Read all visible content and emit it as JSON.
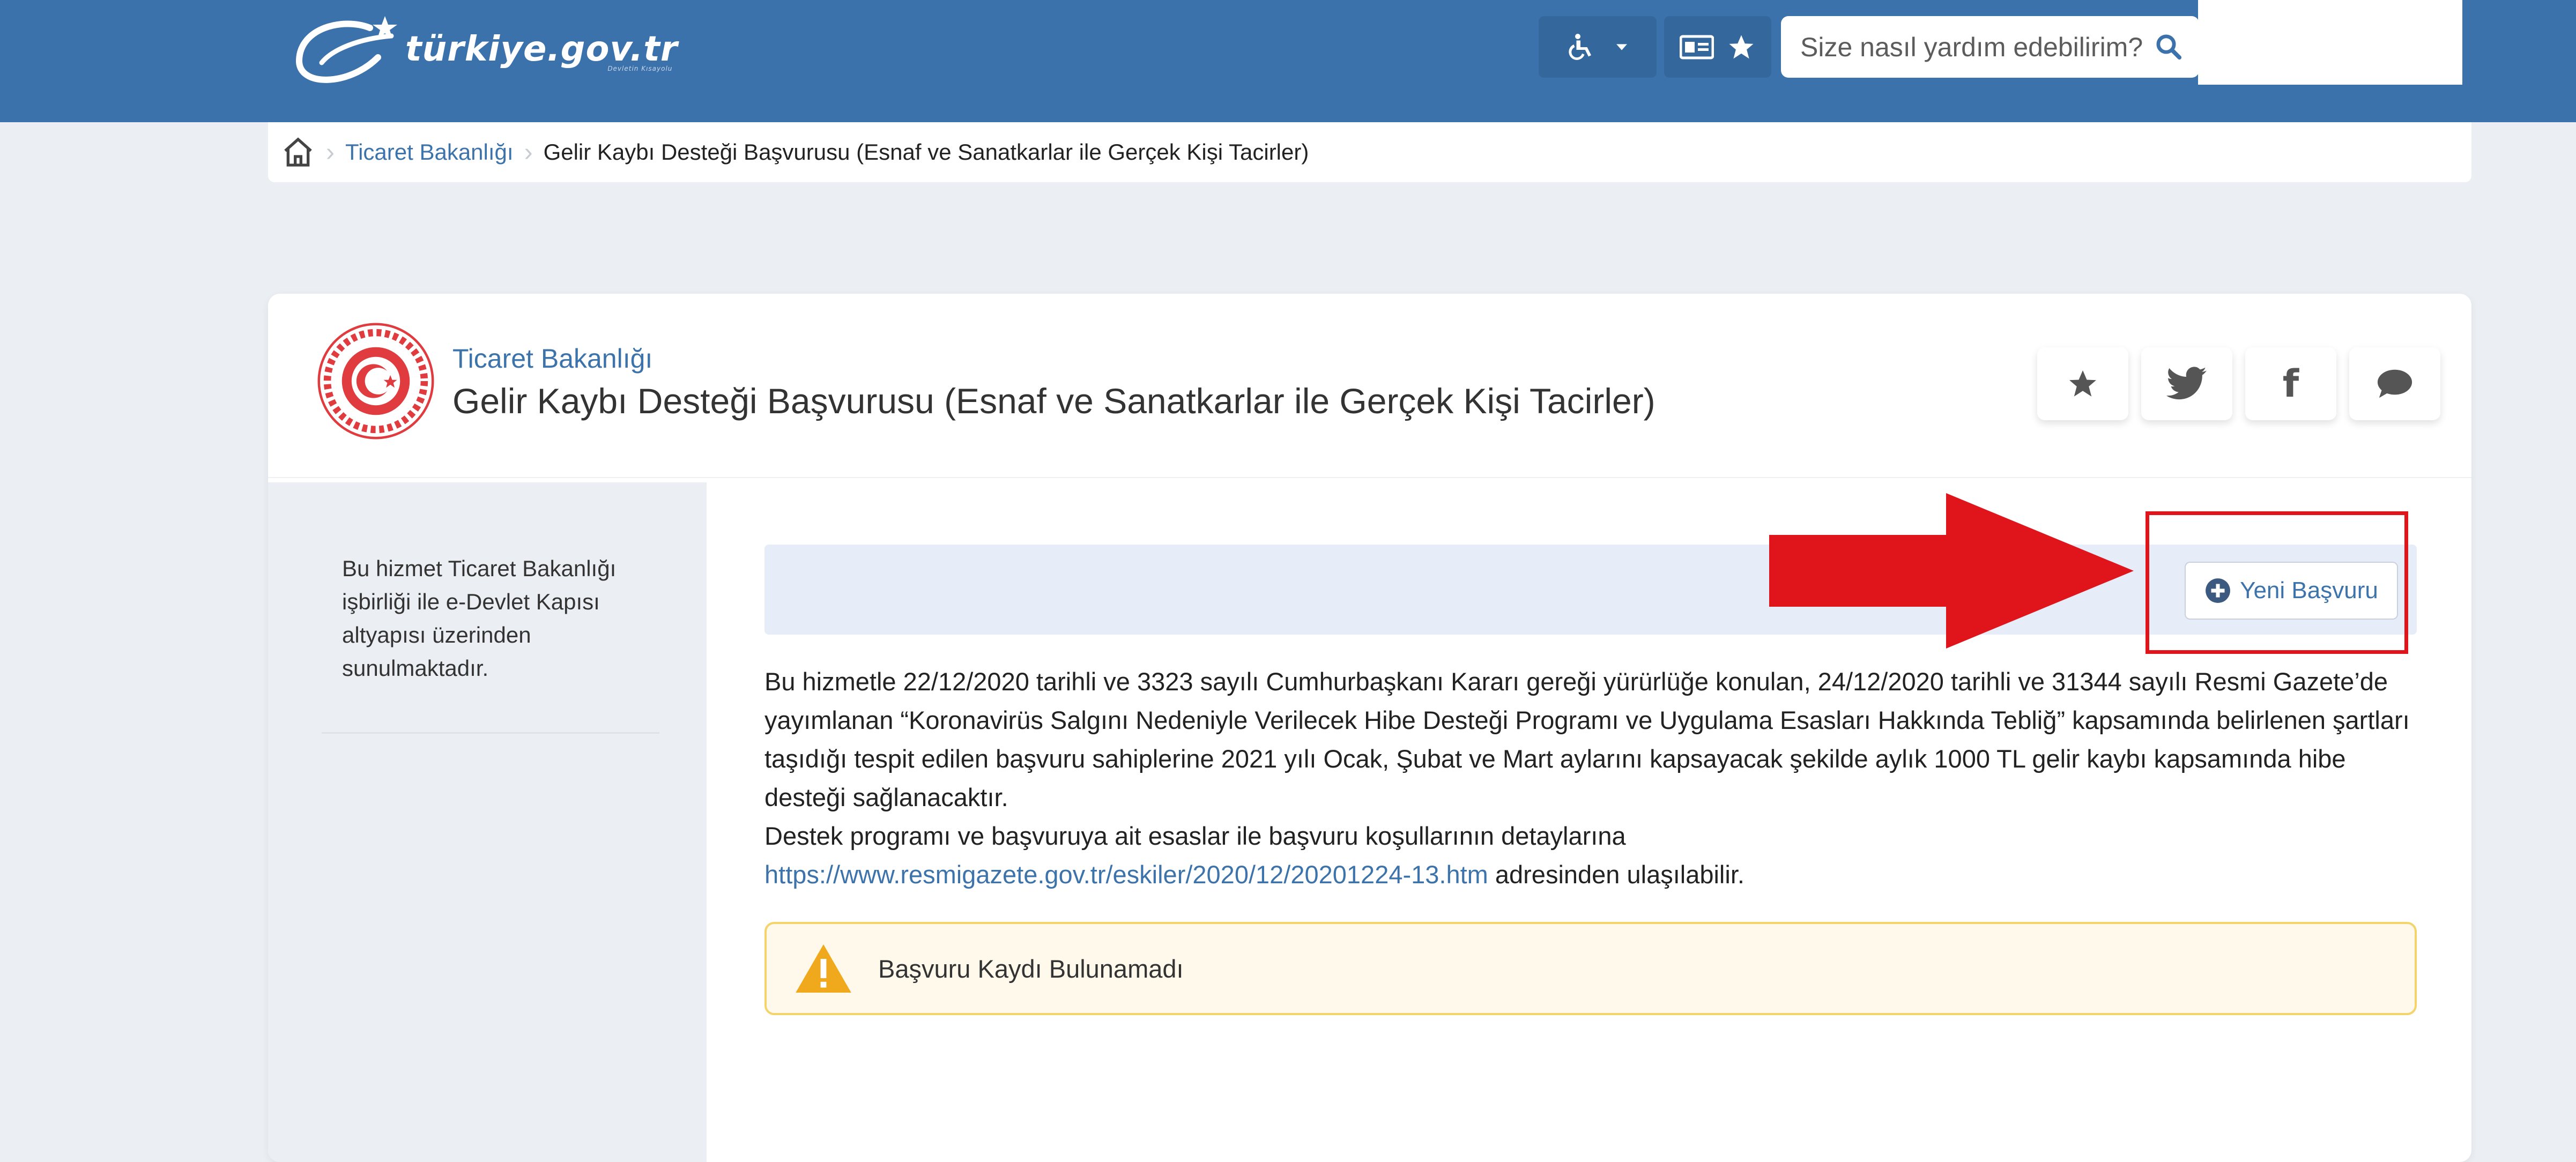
{
  "header": {
    "logo_text": "türkiye.gov.tr",
    "logo_sub": "Devletin Kısayolu",
    "search_placeholder": "Size nasıl yardım edebilirim?",
    "icons": [
      "accessibility-icon",
      "chevron-down-icon",
      "id-card-icon",
      "star-icon",
      "search-icon"
    ],
    "brand_color": "#3c72ac"
  },
  "breadcrumb": {
    "items": [
      "Ticaret Bakanlığı",
      "Gelir Kaybı Desteği Başvurusu (Esnaf ve Sanatkarlar ile Gerçek Kişi Tacirler)"
    ]
  },
  "service": {
    "agency": "Ticaret Bakanlığı",
    "title": "Gelir Kaybı Desteği Başvurusu (Esnaf ve Sanatkarlar ile Gerçek Kişi Tacirler)",
    "share_icons": [
      "star-icon",
      "twitter-icon",
      "facebook-icon",
      "comment-icon"
    ],
    "sidebar_note": "Bu hizmet Ticaret Bakanlığı işbirliği ile e-Devlet Kapısı altyapısı üzerinden sunulmaktadır.",
    "new_button_label": "Yeni Başvuru",
    "description_p1": "Bu hizmetle 22/12/2020 tarihli ve 3323 sayılı Cumhurbaşkanı Kararı gereği yürürlüğe konulan, 24/12/2020 tarihli ve 31344 sayılı Resmi Gazete’de yayımlanan “Koronavirüs Salgını Nedeniyle Verilecek Hibe Desteği Programı ve Uygulama Esasları Hakkında Tebliğ” kapsamında belirlenen şartları taşıdığı tespit edilen başvuru sahiplerine 2021 yılı Ocak, Şubat ve Mart aylarını kapsayacak şekilde aylık 1000 TL gelir kaybı kapsamında hibe desteği sağlanacaktır.",
    "description_p2": "Destek programı ve başvuruya ait esaslar ile başvuru koşullarının detaylarına",
    "link": "https://www.resmigazete.gov.tr/eskiler/2020/12/20201224-13.htm",
    "link_suffix": " adresinden ulaşılabilir.",
    "warning": "Başvuru Kaydı Bulunamadı",
    "annotation_color": "#e0141b"
  }
}
